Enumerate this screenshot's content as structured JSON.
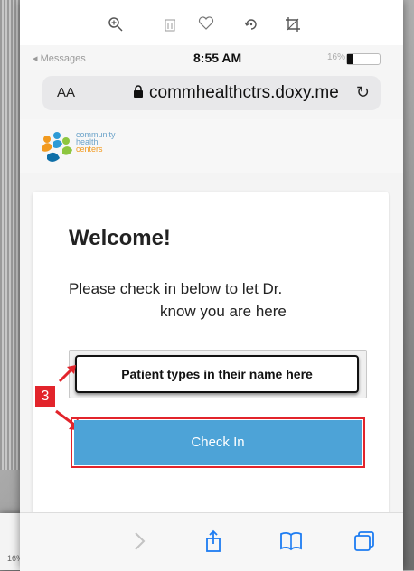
{
  "background": {
    "mini_battery_percent_label": "16%"
  },
  "toolbar": {
    "zoom_icon": "zoom-in-icon",
    "delete_icon": "trash-icon",
    "favorite_icon": "heart-icon",
    "rotate_icon": "rotate-icon",
    "crop_icon": "crop-icon"
  },
  "status": {
    "left": "◂ Messages",
    "time": "8:55 AM",
    "battery_percent": "16%",
    "battery_level": 0.16
  },
  "browser": {
    "text_size_label": "AA",
    "url": "commhealthctrs.doxy.me",
    "reload_icon": "reload-icon"
  },
  "brand": {
    "line1": "community",
    "line2": "health",
    "line3": "centers"
  },
  "page": {
    "welcome": "Welcome!",
    "desc_line1": "Please check in below to let Dr.",
    "desc_line2": "know you are here",
    "name_overlay": "Patient types in their name here",
    "step_badge": "3",
    "checkin_label": "Check In"
  },
  "colors": {
    "accent_blue": "#4da3d7",
    "annotation_red": "#e2242b"
  },
  "nav": {
    "forward_icon": "chevron-right-icon",
    "share_icon": "share-icon",
    "bookmarks_icon": "book-icon",
    "tabs_icon": "tabs-icon"
  }
}
